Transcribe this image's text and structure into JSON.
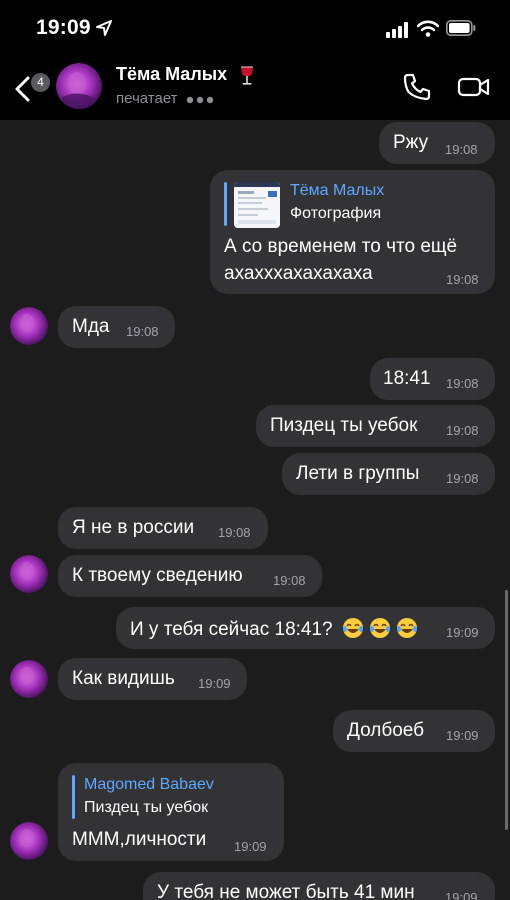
{
  "status_bar": {
    "time": "19:09"
  },
  "header": {
    "back_count": "4",
    "contact_name": "Тёма Малых",
    "status": "печатает",
    "icons": [
      "chevron-left-icon",
      "phone-icon",
      "video-camera-icon",
      "wine-glass-icon"
    ]
  },
  "messages": [
    {
      "side": "out",
      "text": "Ржу",
      "time": "19:08"
    },
    {
      "side": "out",
      "reply_author": "Тёма Малых",
      "reply_text": "Фотография",
      "text_line1": "А со временем то что ещё",
      "text_line2": "ахахххахахахаха",
      "time": "19:08"
    },
    {
      "side": "in",
      "text": "Мда",
      "time": "19:08"
    },
    {
      "side": "out",
      "text": "18:41",
      "time": "19:08"
    },
    {
      "side": "out",
      "text": "Пиздец ты уебок",
      "time": "19:08"
    },
    {
      "side": "out",
      "text": "Лети в группы",
      "time": "19:08"
    },
    {
      "side": "in",
      "text": "Я не в россии",
      "time": "19:08"
    },
    {
      "side": "in",
      "text": "К твоему сведению",
      "time": "19:08"
    },
    {
      "side": "out",
      "text": "И у тебя сейчас 18:41?",
      "emoji": "😂😂😂",
      "time": "19:09"
    },
    {
      "side": "in",
      "text": "Как видишь",
      "time": "19:09"
    },
    {
      "side": "out",
      "text": "Долбоеб",
      "time": "19:09"
    },
    {
      "side": "in",
      "reply_author": "Magomed Babaev",
      "reply_text": "Пиздец ты уебок",
      "text": "МММ,личности",
      "time": "19:09"
    },
    {
      "side": "out",
      "text": "У тебя не может быть 41 мин",
      "time": "19:09"
    }
  ],
  "colors": {
    "outgoing_bubble": "#333335",
    "chat_background": "#1c1c1d",
    "accent": "#5ea8ff"
  }
}
